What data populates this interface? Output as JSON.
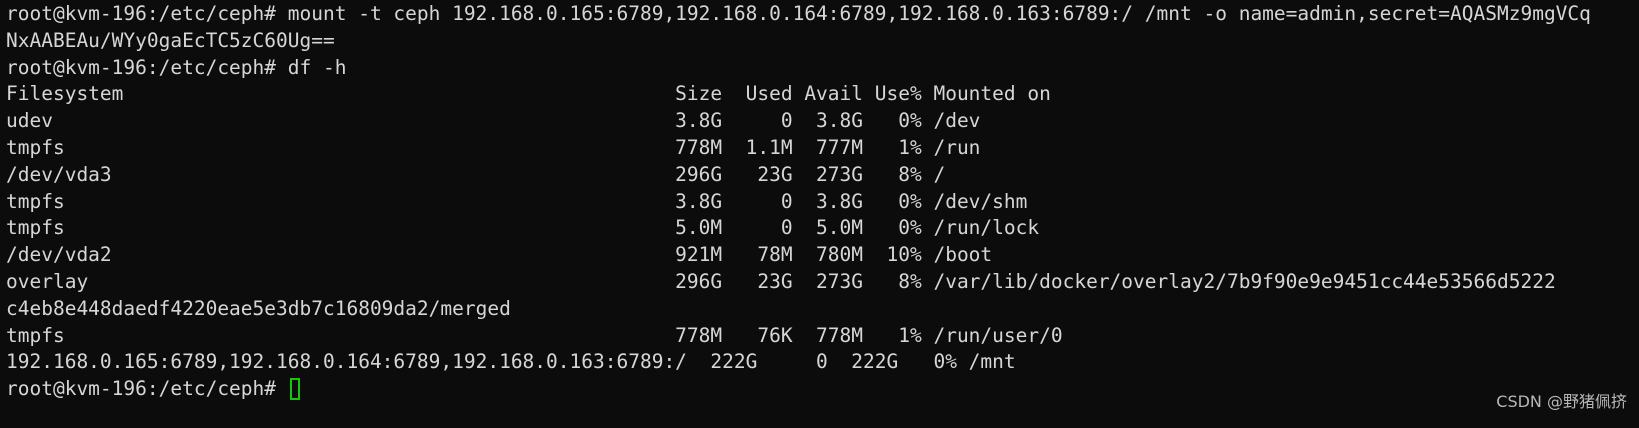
{
  "terminal": {
    "lines": [
      "root@kvm-196:/etc/ceph# mount -t ceph 192.168.0.165:6789,192.168.0.164:6789,192.168.0.163:6789:/ /mnt -o name=admin,secret=AQASMz9mgVCq",
      "NxAABEAu/WYy0gaEcTC5zC60Ug==",
      "root@kvm-196:/etc/ceph# df -h",
      "Filesystem                                               Size  Used Avail Use% Mounted on",
      "udev                                                     3.8G     0  3.8G   0% /dev",
      "tmpfs                                                    778M  1.1M  777M   1% /run",
      "/dev/vda3                                                296G   23G  273G   8% /",
      "tmpfs                                                    3.8G     0  3.8G   0% /dev/shm",
      "tmpfs                                                    5.0M     0  5.0M   0% /run/lock",
      "/dev/vda2                                                921M   78M  780M  10% /boot",
      "overlay                                                  296G   23G  273G   8% /var/lib/docker/overlay2/7b9f90e9e9451cc44e53566d5222",
      "c4eb8e448daedf4220eae5e3db7c16809da2/merged",
      "tmpfs                                                    778M   76K  778M   1% /run/user/0",
      "192.168.0.165:6789,192.168.0.164:6789,192.168.0.163:6789:/  222G     0  222G   0% /mnt"
    ],
    "prompt": "root@kvm-196:/etc/ceph# "
  },
  "watermark": "CSDN @野猪佩挤",
  "colors": {
    "background": "#0c0c0c",
    "text": "#d6d6d6",
    "cursor": "#16c60c"
  }
}
